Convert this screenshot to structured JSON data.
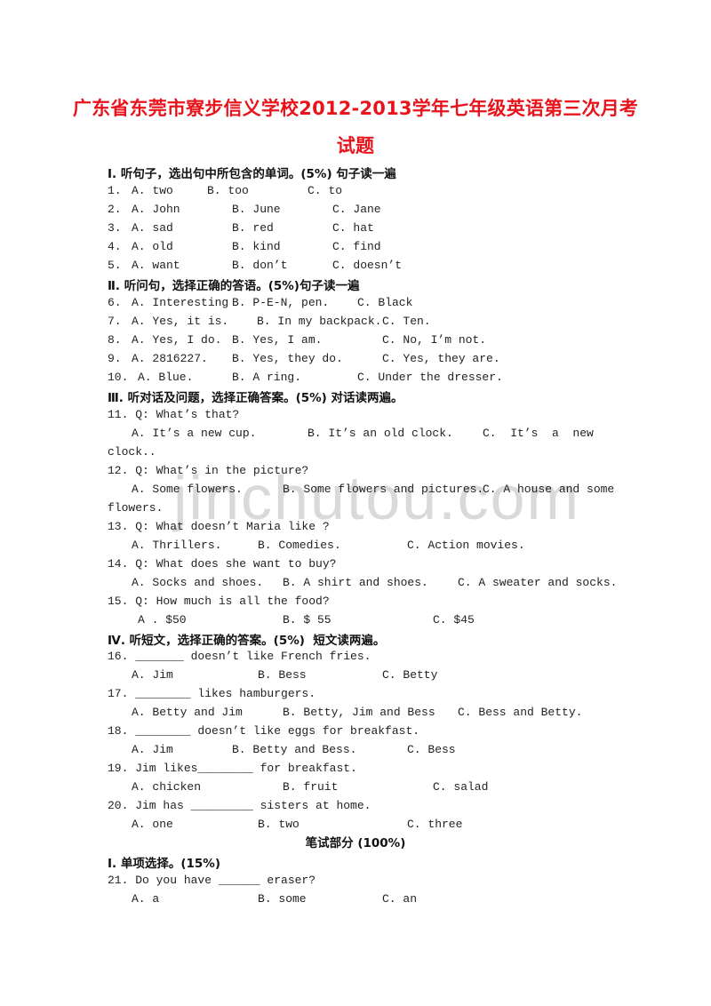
{
  "title": {
    "line1": "广东省东莞市寮步信义学校2012-2013学年七年级英语第三次月考",
    "line2": "试题"
  },
  "watermark": "jinchutou.com",
  "sections": {
    "s1": {
      "heading": "Ⅰ. 听句子，选出句中所包含的单词。(5%) 句子读一遍"
    },
    "s2": {
      "heading": "Ⅱ. 听问句，选择正确的答语。(5%)句子读一遍"
    },
    "s3": {
      "heading": "Ⅲ. 听对话及问题，选择正确答案。(5%) 对话读两遍。"
    },
    "s4": {
      "heading": "Ⅳ. 听短文，选择正确的答案。(5%)  短文读两遍。"
    },
    "written": {
      "heading": "笔试部分 (100%)"
    },
    "w1": {
      "heading": "I. 单项选择。(15%)"
    }
  },
  "q": {
    "q1": {
      "num": "1.",
      "a": "A. two",
      "b": "B. too",
      "c": "C. to"
    },
    "q2": {
      "num": "2.",
      "a": "A. John",
      "b": "B. June",
      "c": "C. Jane"
    },
    "q3": {
      "num": "3.",
      "a": "A. sad",
      "b": "B. red",
      "c": "C. hat"
    },
    "q4": {
      "num": "4.",
      "a": "A. old",
      "b": "B. kind",
      "c": "C. find"
    },
    "q5": {
      "num": "5.",
      "a": "A. want",
      "b": "B. don’t",
      "c": "C. doesn’t"
    },
    "q6": {
      "num": "6.",
      "a": "A. Interesting",
      "b": "B. P-E-N, pen.",
      "c": "C. Black"
    },
    "q7": {
      "num": "7.",
      "a": "A. Yes, it is.",
      "b": "B. In my backpack.",
      "c": "C. Ten."
    },
    "q8": {
      "num": "8.",
      "a": "A. Yes, I do.",
      "b": "B. Yes, I am.",
      "c": "C. No, I’m not."
    },
    "q9": {
      "num": "9.",
      "a": "A. 2816227.",
      "b": "B. Yes, they do.",
      "c": "C. Yes, they are."
    },
    "q10": {
      "num": "10.",
      "a": "A. Blue.",
      "b": "B. A ring.",
      "c": "C. Under the dresser."
    },
    "q11": {
      "stem": "11. Q: What’s that?",
      "a": "A. It’s a new cup.",
      "b": "B. It’s an old clock.",
      "c": "C.  It’s  a  new",
      "c_cont": "clock.."
    },
    "q12": {
      "stem": "12. Q: What’s in the picture?",
      "a": "A. Some flowers.",
      "b": "B. Some flowers and pictures.",
      "c": "C. A house and some",
      "c_cont": "flowers."
    },
    "q13": {
      "stem": "13. Q: What doesn’t Maria like ?",
      "a": "A. Thrillers.",
      "b": "B. Comedies.",
      "c": "C. Action movies."
    },
    "q14": {
      "stem": "14. Q: What does she want to buy?",
      "a": "A. Socks and shoes.",
      "b": "B. A shirt and shoes.",
      "c": "C. A sweater and socks."
    },
    "q15": {
      "stem": "15. Q: How much is all the food?",
      "a": "A . $50",
      "b": "B. $ 55",
      "c": "C. $45"
    },
    "q16": {
      "stem": "16. _______ doesn’t like French fries.",
      "a": "A. Jim",
      "b": "B. Bess",
      "c": "C. Betty"
    },
    "q17": {
      "stem": "17. ________ likes hamburgers.",
      "a": "A. Betty and Jim",
      "b": "B. Betty, Jim and Bess",
      "c": "C. Bess and Betty."
    },
    "q18": {
      "stem": "18. ________ doesn’t like eggs for breakfast.",
      "a": "A. Jim",
      "b": "B. Betty and Bess.",
      "c": "C. Bess"
    },
    "q19": {
      "stem": "19. Jim likes________ for breakfast.",
      "a": "A. chicken",
      "b": "B. fruit",
      "c": "C. salad"
    },
    "q20": {
      "stem": "20. Jim has _________ sisters at home.",
      "a": "A. one",
      "b": "B. two",
      "c": "C. three"
    },
    "q21": {
      "stem": "21. Do you have ______ eraser?",
      "a": "A. a",
      "b": "B. some",
      "c": "C. an"
    }
  }
}
